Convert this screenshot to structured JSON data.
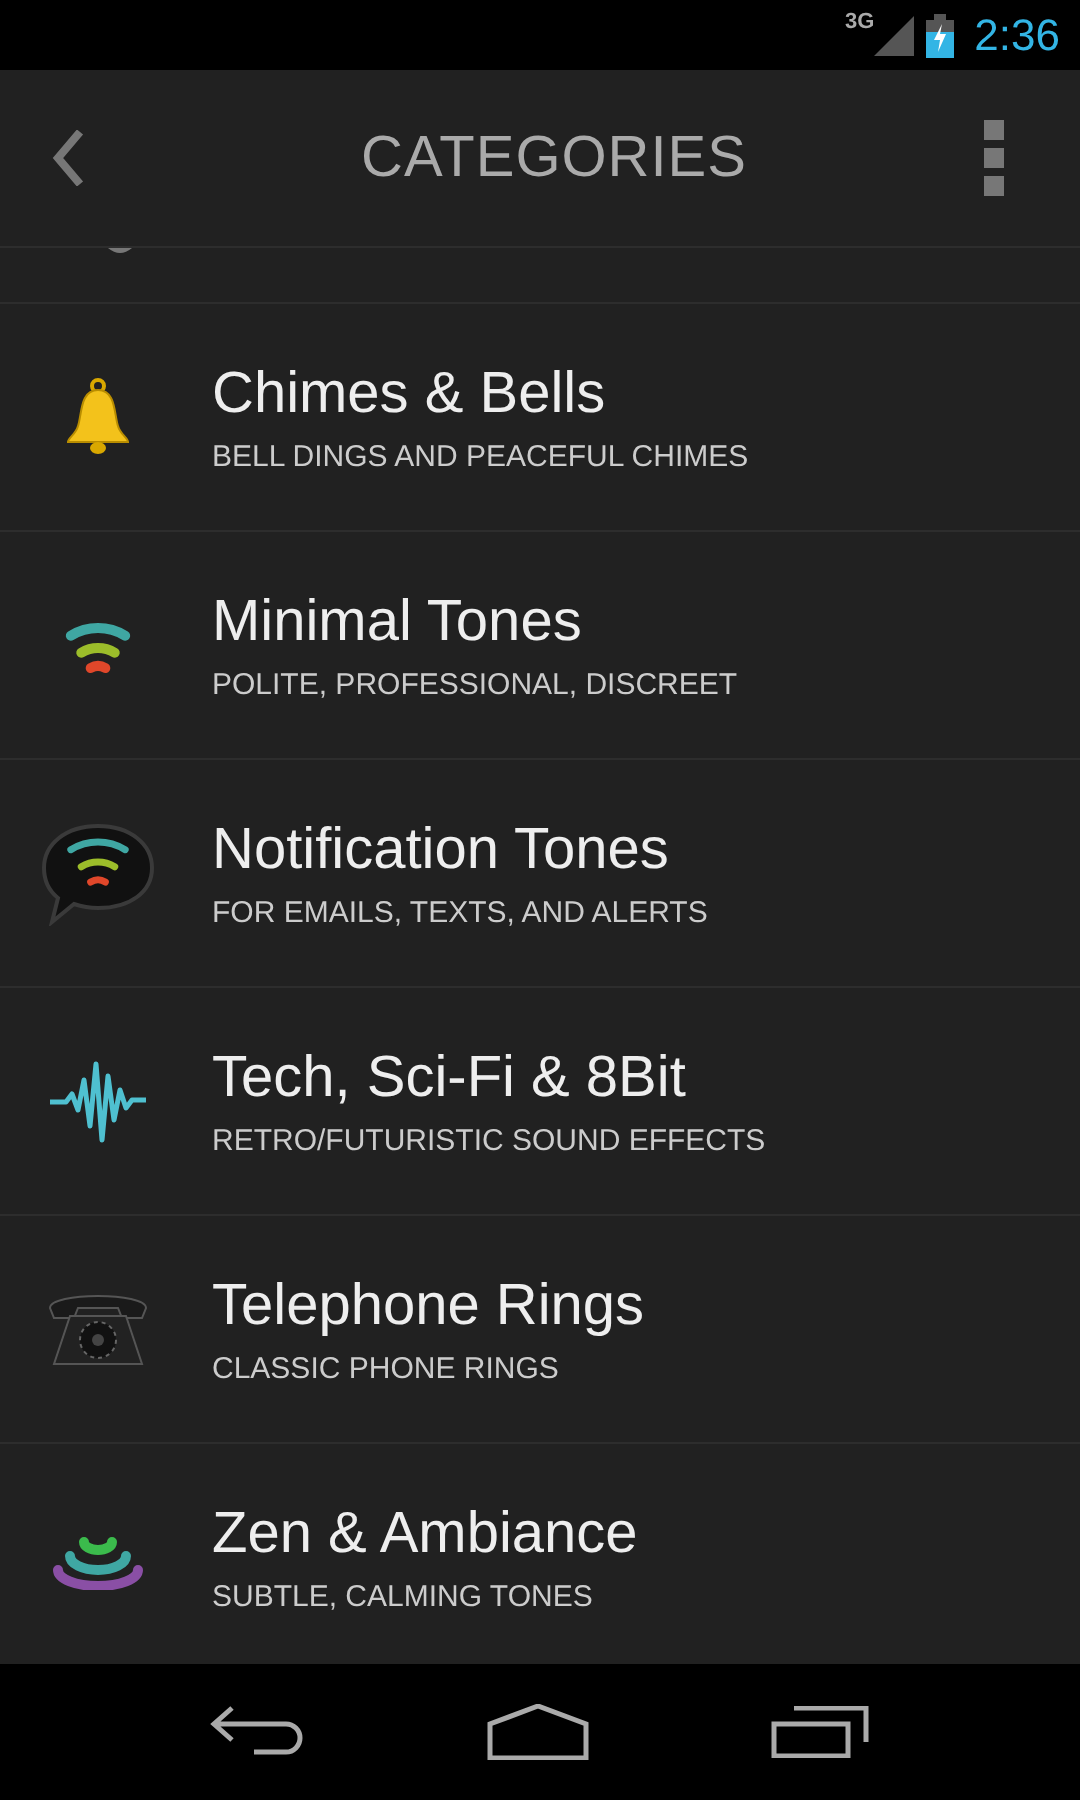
{
  "status_bar": {
    "network": "3G",
    "time": "2:36"
  },
  "action_bar": {
    "title": "CATEGORIES"
  },
  "categories": [
    {
      "kind": "bell",
      "title": "Chimes & Bells",
      "subtitle": "BELL DINGS AND PEACEFUL CHIMES"
    },
    {
      "kind": "waves",
      "title": "Minimal Tones",
      "subtitle": "POLITE, PROFESSIONAL, DISCREET"
    },
    {
      "kind": "bubble",
      "title": "Notification Tones",
      "subtitle": "FOR EMAILS, TEXTS, AND ALERTS"
    },
    {
      "kind": "pulse",
      "title": "Tech, Sci-Fi & 8Bit",
      "subtitle": "RETRO/FUTURISTIC SOUND EFFECTS"
    },
    {
      "kind": "phone",
      "title": "Telephone Rings",
      "subtitle": "CLASSIC PHONE RINGS"
    },
    {
      "kind": "zen",
      "title": "Zen & Ambiance",
      "subtitle": "SUBTLE, CALMING TONES"
    }
  ]
}
